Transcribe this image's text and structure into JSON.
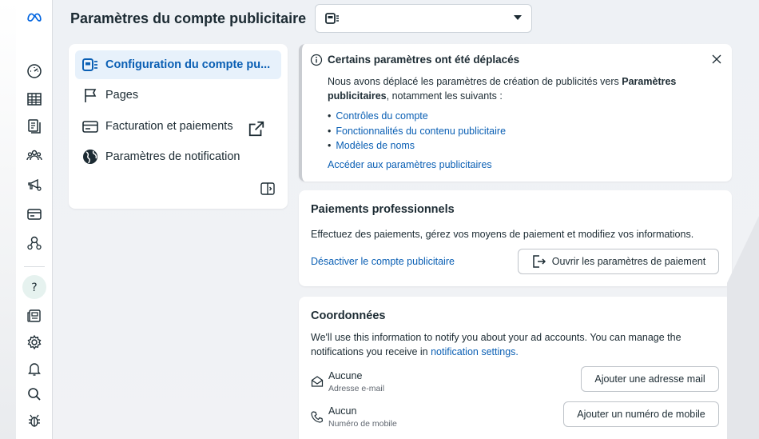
{
  "page": {
    "title": "Paramètres du compte publicitaire"
  },
  "account_select": {
    "value": ""
  },
  "sidenav": {
    "items": [
      {
        "label": "Configuration du compte pu...",
        "icon": "ad-account-icon",
        "active": true
      },
      {
        "label": "Pages",
        "icon": "flag-icon"
      },
      {
        "label": "Facturation et paiements",
        "icon": "credit-card-icon",
        "external": true
      },
      {
        "label": "Paramètres de notification",
        "icon": "globe-icon"
      }
    ]
  },
  "notice": {
    "title": "Certains paramètres ont été déplacés",
    "body_prefix": "Nous avons déplacé les paramètres de création de publicités vers ",
    "body_bold": "Paramètres publicitaires",
    "body_suffix": ", notamment les suivants :",
    "list": [
      "Contrôles du compte",
      "Fonctionnalités du contenu publicitaire",
      "Modèles de noms"
    ],
    "link": "Accéder aux paramètres publicitaires"
  },
  "payments": {
    "title": "Paiements professionnels",
    "text": "Effectuez des paiements, gérez vos moyens de paiement et modifiez vos informations.",
    "deactivate_link": "Désactiver le compte publicitaire",
    "open_button": "Ouvrir les paramètres de paiement"
  },
  "contact": {
    "title": "Coordonnées",
    "text_prefix": "We'll use this information to notify you about your ad accounts. You can manage the notifications you receive in ",
    "text_link": "notification settings.",
    "email": {
      "value": "Aucune",
      "label": "Adresse e-mail",
      "button": "Ajouter une adresse mail"
    },
    "mobile": {
      "value": "Aucun",
      "label": "Numéro de mobile",
      "button": "Ajouter un numéro de mobile"
    }
  },
  "colors": {
    "link": "#0a5fb4",
    "active_bg": "#e7f1fb",
    "meta_blue": "#0064e0"
  }
}
